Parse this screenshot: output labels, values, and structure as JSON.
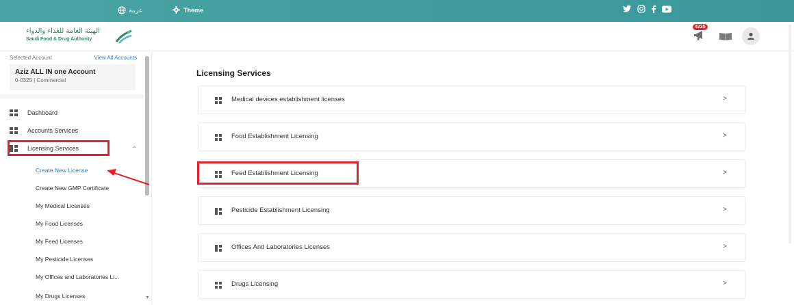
{
  "topbar": {
    "lang_label": "عربية",
    "theme_label": "Theme",
    "social": [
      "twitter-icon",
      "instagram-icon",
      "facebook-icon",
      "youtube-icon"
    ]
  },
  "header": {
    "logo_ar": "الهيئة العامة للغذاء والدواء",
    "logo_en": "Saudi Food & Drug Authority",
    "notification_count": "4235"
  },
  "sidebar": {
    "selected_account_label": "Selected Account",
    "view_all_label": "View All Accounts",
    "account_name": "Aziz ALL IN one Account",
    "account_sub": "0-0325 | Commercial",
    "nav": [
      {
        "label": "Dashboard"
      },
      {
        "label": "Accounts Services"
      },
      {
        "label": "Licensing Services"
      }
    ],
    "sub": [
      {
        "label": "Create New License"
      },
      {
        "label": "Create New GMP Certificate"
      },
      {
        "label": "My Medical Licenses"
      },
      {
        "label": "My Food Licenses"
      },
      {
        "label": "My Feed Licenses"
      },
      {
        "label": "My Pesticide Licenses"
      },
      {
        "label": "My Offices and Laboratories Li..."
      },
      {
        "label": "My Drugs Licenses"
      }
    ]
  },
  "main": {
    "title": "Licensing Services",
    "cards": [
      {
        "label": "Medical devices establishment licenses"
      },
      {
        "label": "Food Establishment Licensing"
      },
      {
        "label": "Feed Establishment Licensing"
      },
      {
        "label": "Pesticide Establishment Licensing"
      },
      {
        "label": "Offices And Laboratories Licenses"
      },
      {
        "label": "Drugs Licensing"
      }
    ],
    "chevron": ">"
  },
  "colors": {
    "topbar": "#3e9c9e",
    "highlight": "#e3202a",
    "active_link": "#2a78c6"
  }
}
